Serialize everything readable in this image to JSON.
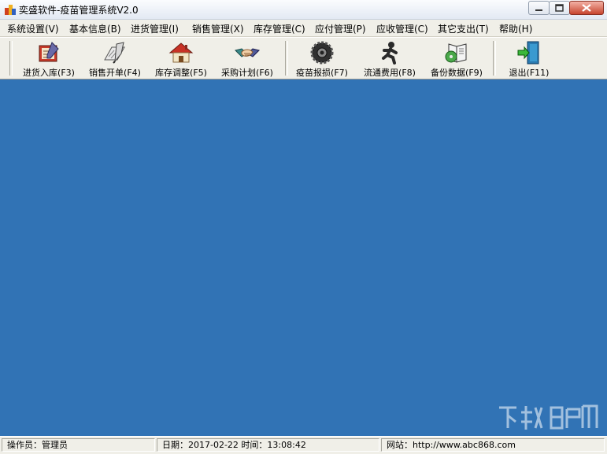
{
  "window": {
    "title": "奕盛软件-疫苗管理系统V2.0"
  },
  "menubar": {
    "items": [
      {
        "label": "系统设置(V)"
      },
      {
        "label": "基本信息(B)"
      },
      {
        "label": "进货管理(I)"
      },
      {
        "label": "销售管理(X)"
      },
      {
        "label": "库存管理(C)"
      },
      {
        "label": "应付管理(P)"
      },
      {
        "label": "应收管理(C)"
      },
      {
        "label": "其它支出(T)"
      },
      {
        "label": "帮助(H)"
      }
    ]
  },
  "toolbar": {
    "buttons": [
      {
        "label": "进货入库(F3)",
        "icon": "purchase-stock-icon"
      },
      {
        "label": "销售开单(F4)",
        "icon": "sales-order-icon"
      },
      {
        "label": "库存调整(F5)",
        "icon": "house-icon"
      },
      {
        "label": "采购计划(F6)",
        "icon": "handshake-icon"
      },
      {
        "label": "疫苗报损(F7)",
        "icon": "gear-icon"
      },
      {
        "label": "流通费用(F8)",
        "icon": "running-man-icon"
      },
      {
        "label": "备份数据(F9)",
        "icon": "book-cd-icon"
      },
      {
        "label": "退出(F11)",
        "icon": "exit-door-icon"
      }
    ]
  },
  "statusbar": {
    "operator": "操作员：管理员",
    "datetime": "日期：2017-02-22 时间：13:08:42",
    "website": "网站：http://www.abc868.com"
  },
  "colors": {
    "client_background": "#3173b5",
    "window_background": "#f0efe8"
  }
}
